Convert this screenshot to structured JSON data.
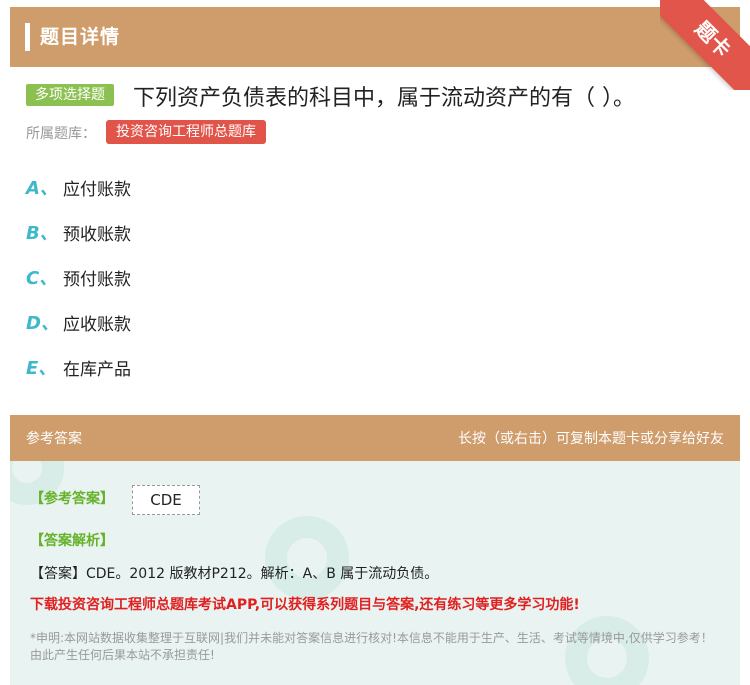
{
  "header": {
    "title": "题目详情",
    "corner_label": "题卡"
  },
  "question": {
    "type_tag": "多项选择题",
    "text": "下列资产负债表的科目中，属于流动资产的有（   ）。",
    "bank_label": "所属题库：",
    "bank_name": "投资咨询工程师总题库"
  },
  "options": [
    {
      "letter": "A、",
      "text": "应付账款"
    },
    {
      "letter": "B、",
      "text": "预收账款"
    },
    {
      "letter": "C、",
      "text": "预付账款"
    },
    {
      "letter": "D、",
      "text": "应收账款"
    },
    {
      "letter": "E、",
      "text": "在库产品"
    }
  ],
  "answer_section": {
    "title": "参考答案",
    "hint": "长按（或右击）可复制本题卡或分享给好友",
    "answer_label": "【参考答案】",
    "answer_value": "CDE",
    "analysis_label": "【答案解析】",
    "analysis_text": "【答案】CDE。2012 版教材P212。解析：A、B 属于流动负债。",
    "promo": "下载投资咨询工程师总题库考试APP,可以获得系列题目与答案,还有练习等更多学习功能!",
    "disclaimer": "*申明:本网站数据收集整理于互联网|我们并未能对答案信息进行核对!本信息不能用于生产、生活、考试等情境中,仅供学习参考！由此产生任何后果本站不承担责任!"
  },
  "colors": {
    "header": "#cf9c6c",
    "accent_red": "#e0544a",
    "accent_green": "#8cc152",
    "option_letter": "#3fb8c9"
  }
}
